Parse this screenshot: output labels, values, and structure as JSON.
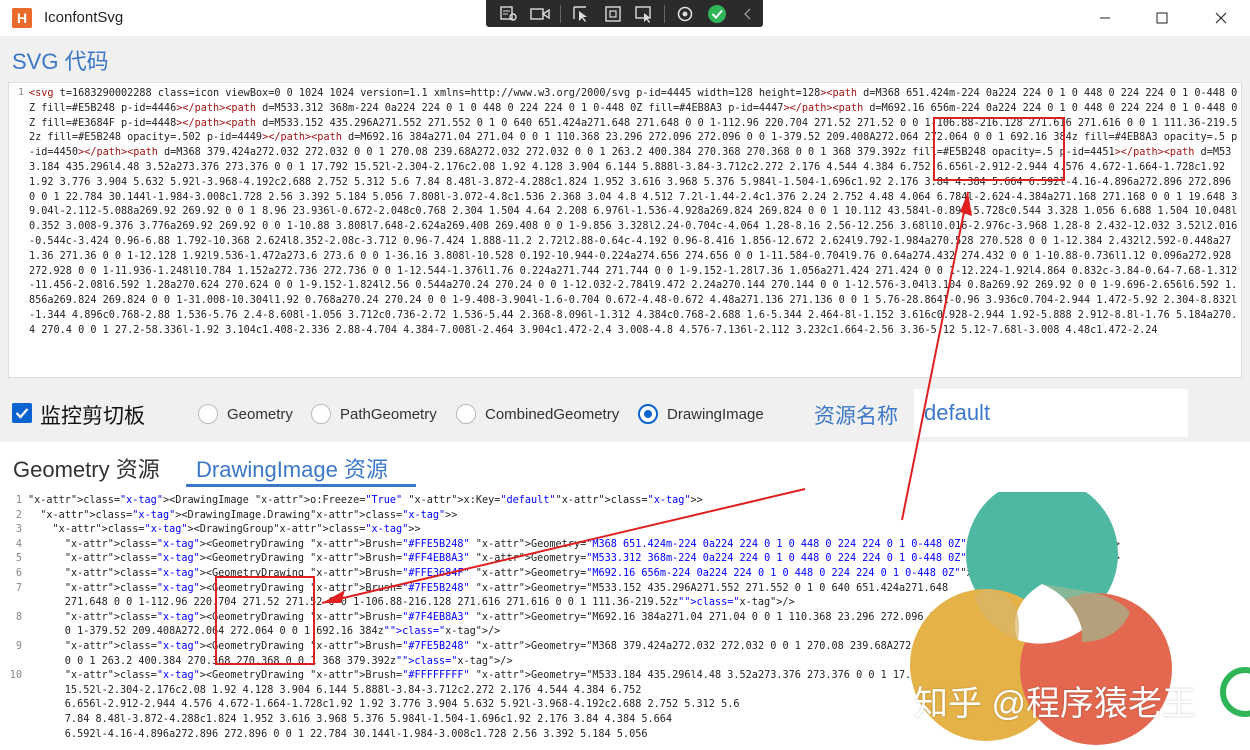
{
  "window": {
    "app_icon_letter": "H",
    "title": "IconfontSvg",
    "float_toolbar_icons": [
      "screenshot-settings-icon",
      "record-icon",
      "select-pointer-icon",
      "region-icon",
      "window-select-icon",
      "refresh-icon",
      "check-circle-icon",
      "collapse-left-icon"
    ],
    "controls": [
      "minimize-icon",
      "maximize-icon",
      "close-icon"
    ]
  },
  "svg_section": {
    "heading": "SVG 代码",
    "line_number": "1",
    "code": "<svg t=\"1683290002288\" class=\"icon\" viewBox=\"0 0 1024 1024\" version=\"1.1\" xmlns=\"http://www.w3.org/2000/svg\" p-id=\"4445\" width=\"128\" height=\"128\"><path d=\"M368 651.424m-224 0a224 224 0 1 0 448 0 224 224 0 1 0-448 0Z\" fill=\"#E5B248\" p-id=\"4446\"></path><path d=\"M533.312 368m-224 0a224 224 0 1 0 448 0 224 224 0 1 0-448 0Z\" fill=\"#4EB8A3\" p-id=\"4447\"></path><path d=\"M692.16 656m-224 0a224 224 0 1 0 448 0 224 224 0 1 0-448 0Z\" fill=\"#E3684F\" p-id=\"4448\"></path><path d=\"M533.152 435.296A271.552 271.552 0 1 0 640 651.424a271.648 271.648 0 0 1-112.96 220.704 271.52 271.52 0 0 1-106.88-216.128 271.616 271.616 0 0 1 111.36-219.52z\" fill=\"#E5B248\" opacity=\".502\" p-id=\"4449\"></path><path d=\"M692.16 384a271.04 271.04 0 0 1 110.368 23.296 272.096 272.096 0 0 1-379.52 209.408A272.064 272.064 0 0 1 692.16 384z\" fill=\"#4EB8A3\" opacity=\".5\" p-id=\"4450\"></path><path d=\"M368 379.424a272.032 272.032 0 0 1 270.08 239.68A272.032 272.032 0 0 1 263.2 400.384 270.368 270.368 0 0 1 368 379.392z\" fill=\"#E5B248\" opacity=\".5\" p-id=\"4451\"></path><path d=\"M533.184 435.296l4.48 3.52a273.376 273.376 0 0 1 17.792 15.52l-2.304-2.176c2.08 1.92 4.128 3.904 6.144 5.888l-3.84-3.712c2.272 2.176 4.544 4.384 6.752 6.656l-2.912-2.944 4.576 4.672-1.664-1.728c1.92 1.92 3.776 3.904 5.632 5.92l-3.968-4.192c2.688 2.752 5.312 5.6 7.84 8.48l-3.872-4.288c1.824 1.952 3.616 3.968 5.376 5.984l-1.504-1.696c1.92 2.176 3.84 4.384 5.664 6.592l-4.16-4.896a272.896 272.896 0 0 1 22.784 30.144l-1.984-3.008c1.728 2.56 3.392 5.184 5.056 7.808l-3.072-4.8c1.536 2.368 3.04 4.8 4.512 7.2l-1.44-2.4c1.376 2.24 2.752 4.48 4.064 6.784l-2.624-4.384a271.168 271.168 0 0 1 19.648 39.04l-2.112-5.088a269.92 269.92 0 0 1 8.96 23.936l-0.672-2.048c0.768 2.304 1.504 4.64 2.208 6.976l-1.536-4.928a269.824 269.824 0 0 1 10.112 43.584l-0.896-5.728c0.544 3.328 1.056 6.688 1.504 10.048l0.352 3.008-9.376 3.776a269.92 269.92 0 0 1-10.88 3.808l7.648-2.624a269.408 269.408 0 0 1-9.856 3.328l2.24-0.704c-4.064 1.28-8.16 2.56-12.256 3.68l10.016-2.976c-3.968 1.28-8 2.432-12.032 3.52l2.016-0.544c-3.424 0.96-6.88 1.792-10.368 2.624l8.352-2.08c-3.712 0.96-7.424 1.888-11.2 2.72l2.88-0.64c-4.192 0.96-8.416 1.856-12.672 2.624l9.792-1.984a270.528 270.528 0 0 1-12.384 2.432l2.592-0.448a271.36 271.36 0 0 1-12.128 1.92l9.536-1.472a273.6 273.6 0 0 1-36.16 3.808l-10.528 0.192-10.944-0.224a274.656 274.656 0 0 1-11.584-0.704l9.76 0.64a274.432 274.432 0 0 1-10.88-0.736l1.12 0.096a272.928 272.928 0 0 1-11.936-1.248l10.784 1.152a272.736 272.736 0 0 1-12.544-1.376l1.76 0.224a271.744 271.744 0 0 1-9.152-1.28l7.36 1.056a271.424 271.424 0 0 1-12.224-1.92l4.864 0.832c-3.84-0.64-7.68-1.312-11.456-2.08l6.592 1.28a270.624 270.624 0 0 1-9.152-1.824l2.56 0.544a270.24 270.24 0 0 1-12.032-2.784l9.472 2.24a270.144 270.144 0 0 1-12.576-3.04l3.104 0.8a269.92 269.92 0 0 1-9.696-2.656l6.592 1.856a269.824 269.824 0 0 1-31.008-10.304l1.92 0.768a270.24 270.24 0 0 1-9.408-3.904l-1.6-0.704 0.672-4.48-0.672 4.48a271.136 271.136 0 0 1 5.76-28.864l-0.96 3.936c0.704-2.944 1.472-5.92 2.304-8.832l-1.344 4.896c0.768-2.88 1.536-5.76 2.4-8.608l-1.056 3.712c0.736-2.72 1.536-5.44 2.368-8.096l-1.312 4.384c0.768-2.688 1.6-5.344 2.464-8l-1.152 3.616c0.928-2.944 1.92-5.888 2.912-8.8l-1.76 5.184a270.4 270.4 0 0 1 27.2-58.336l-1.92 3.104c1.408-2.336 2.88-4.704 4.384-7.008l-2.464 3.904c1.472-2.4 3.008-4.8 4.576-7.136l-2.112 3.232c1.664-2.56 3.36-5.12 5.12-7.68l-3.008 4.48c1.472-2.24"
  },
  "options": {
    "monitor_clipboard": "监控剪切板",
    "monitor_checked": true,
    "radios": [
      {
        "label": "Geometry",
        "selected": false
      },
      {
        "label": "PathGeometry",
        "selected": false
      },
      {
        "label": "CombinedGeometry",
        "selected": false
      },
      {
        "label": "DrawingImage",
        "selected": true
      }
    ],
    "resource_name_label": "资源名称",
    "resource_name_value": "default"
  },
  "tabs": [
    {
      "label": "Geometry 资源",
      "active": false
    },
    {
      "label": "DrawingImage 资源",
      "active": true
    }
  ],
  "xaml": {
    "line_numbers": [
      "1",
      "2",
      "3",
      "4",
      "5",
      "6",
      "7",
      "",
      "8",
      "",
      "9",
      "",
      "10",
      "",
      "",
      "",
      ""
    ],
    "lines": [
      "<DrawingImage o:Freeze=\"True\" x:Key=\"default\">",
      "  <DrawingImage.Drawing>",
      "    <DrawingGroup>",
      "      <GeometryDrawing Brush=\"#FFE5B248\" Geometry=\"M368 651.424m-224 0a224 224 0 1 0 448 0 224 224 0 1 0-448 0Z\"/>",
      "      <GeometryDrawing Brush=\"#FF4EB8A3\" Geometry=\"M533.312 368m-224 0a224 224 0 1 0 448 0 224 224 0 1 0-448 0Z\"/>",
      "      <GeometryDrawing Brush=\"#FFE3684F\" Geometry=\"M692.16 656m-224 0a224 224 0 1 0 448 0 224 224 0 1 0-448 0Z\"/>",
      "      <GeometryDrawing Brush=\"#7FE5B248\" Geometry=\"M533.152 435.296A271.552 271.552 0 1 0 640 651.424a271.648",
      "      271.648 0 0 1-112.96 220.704 271.52 271.52 0 0 1-106.88-216.128 271.616 271.616 0 0 1 111.36-219.52z\"/>",
      "      <GeometryDrawing Brush=\"#7F4EB8A3\" Geometry=\"M692.16 384a271.04 271.04 0 0 1 110.368 23.296 272.096 272.096 0",
      "      0 1-379.52 209.408A272.064 272.064 0 0 1 692.16 384z\"/>",
      "      <GeometryDrawing Brush=\"#7FE5B248\" Geometry=\"M368 379.424a272.032 272.032 0 0 1 270.08 239.68A272.032 272.032",
      "      0 0 1 263.2 400.384 270.368 270.368 0 0 1 368 379.392z\"/>",
      "      <GeometryDrawing Brush=\"#FFFFFFFF\" Geometry=\"M533.184 435.296l4.48 3.52a273.376 273.376 0 0 1 17.792",
      "      15.52l-2.304-2.176c2.08 1.92 4.128 3.904 6.144 5.888l-3.84-3.712c2.272 2.176 4.544 4.384 6.752",
      "      6.656l-2.912-2.944 4.576 4.672-1.664-1.728c1.92 1.92 3.776 3.904 5.632 5.92l-3.968-4.192c2.688 2.752 5.312 5.6",
      "      7.84 8.48l-3.872-4.288c1.824 1.952 3.616 3.968 5.376 5.984l-1.504-1.696c1.92 2.176 3.84 4.384 5.664",
      "      6.592l-4.16-4.896a272.896 272.896 0 0 1 22.784 30.144l-1.984-3.008c1.728 2.56 3.392 5.184 5.056"
    ]
  },
  "preview_icon": {
    "colors": [
      "#4EB8A3",
      "#E5B248",
      "#E3684F"
    ],
    "watermark": "知乎 @程序猿老王"
  },
  "annotation_color": "#E02020"
}
